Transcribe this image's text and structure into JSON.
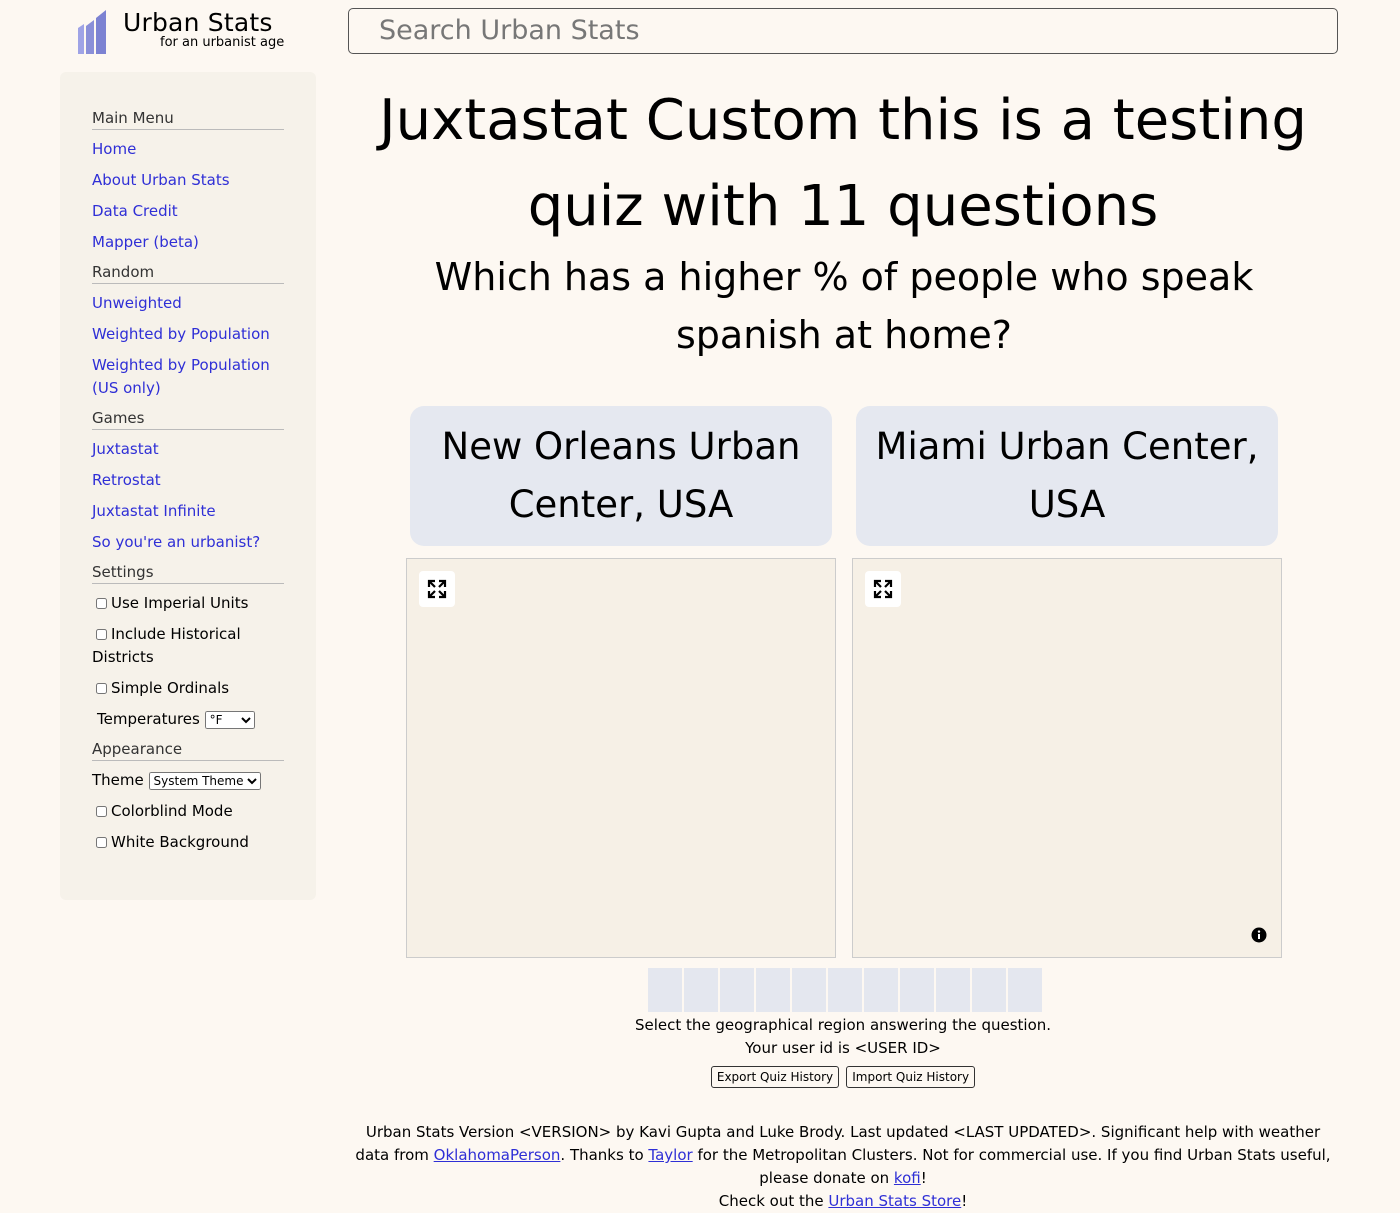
{
  "header": {
    "logo_title": "Urban Stats",
    "logo_subtitle": "for an urbanist age",
    "search_placeholder": "Search Urban Stats"
  },
  "sidebar": {
    "main_menu": {
      "title": "Main Menu",
      "items": [
        "Home",
        "About Urban Stats",
        "Data Credit",
        "Mapper (beta)"
      ]
    },
    "random": {
      "title": "Random",
      "items": [
        "Unweighted",
        "Weighted by Population",
        "Weighted by Population (US only)"
      ]
    },
    "games": {
      "title": "Games",
      "items": [
        "Juxtastat",
        "Retrostat",
        "Juxtastat Infinite",
        "So you're an urbanist?"
      ]
    },
    "settings": {
      "title": "Settings",
      "checkboxes": [
        "Use Imperial Units",
        "Include Historical Districts",
        "Simple Ordinals"
      ],
      "temperatures_label": "Temperatures",
      "temperatures_value": "°F"
    },
    "appearance": {
      "title": "Appearance",
      "theme_label": "Theme",
      "theme_value": "System Theme",
      "checkboxes": [
        "Colorblind Mode",
        "White Background"
      ]
    }
  },
  "quiz": {
    "title": "Juxtastat Custom this is a testing quiz with 11 questions",
    "question": "Which has a higher % of people who speak spanish at home?",
    "choice_a": "New Orleans Urban Center, USA",
    "choice_b": "Miami Urban Center, USA",
    "progress_total": 11,
    "instruction": "Select the geographical region answering the question.",
    "user_id_text": "Your user id is <USER ID>",
    "export_button": "Export Quiz History",
    "import_button": "Import Quiz History"
  },
  "footer": {
    "text1": "Urban Stats Version <VERSION> by Kavi Gupta and Luke Brody. Last updated <LAST UPDATED>. Significant help with weather data from ",
    "link_oklahoma": "OklahomaPerson",
    "text2": ". Thanks to ",
    "link_taylor": "Taylor",
    "text3": " for the Metropolitan Clusters. Not for commercial use. If you find Urban Stats useful, please donate on ",
    "link_kofi": "kofi",
    "text4": "!",
    "text5": "Check out the ",
    "link_store": "Urban Stats Store",
    "text6": "!"
  },
  "colors": {
    "background": "#fdf8f2",
    "sidebar": "#f6f2ea",
    "link": "#2f2fd6",
    "choice": "#e5e8f0",
    "map": "#f6f0e6",
    "logo_purple": "#8a8fd8"
  },
  "icons": [
    "logo-bars-icon",
    "expand-icon",
    "info-icon"
  ]
}
